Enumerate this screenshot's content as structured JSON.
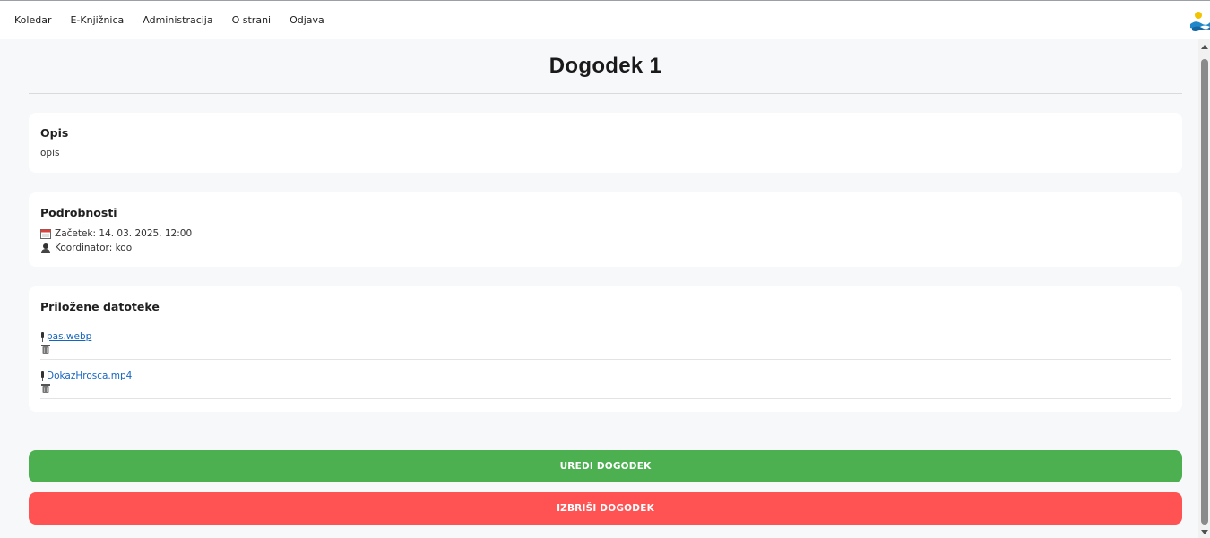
{
  "nav": {
    "items": [
      {
        "label": "Koledar"
      },
      {
        "label": "E-Knjižnica"
      },
      {
        "label": "Administracija"
      },
      {
        "label": "O strani"
      },
      {
        "label": "Odjava"
      }
    ]
  },
  "page": {
    "title": "Dogodek 1"
  },
  "description": {
    "heading": "Opis",
    "text": "opis"
  },
  "details": {
    "heading": "Podrobnosti",
    "start": "Začetek: 14. 03. 2025, 12:00",
    "coordinator": "Koordinator: koo"
  },
  "attachments": {
    "heading": "Priložene datoteke",
    "files": [
      {
        "name": "pas.webp"
      },
      {
        "name": "DokazHrosca.mp4"
      }
    ]
  },
  "actions": {
    "edit_label": "UREDI DOGODEK",
    "delete_label": "IZBRIŠI DOGODEK"
  },
  "colors": {
    "edit_button": "#4caf50",
    "delete_button": "#ff5252",
    "link": "#1565c0"
  },
  "icons": {
    "calendar": "calendar-icon",
    "coordinator": "person-icon",
    "attachment": "pin-icon",
    "delete_file": "trash-icon",
    "logo": "logo-icon"
  }
}
